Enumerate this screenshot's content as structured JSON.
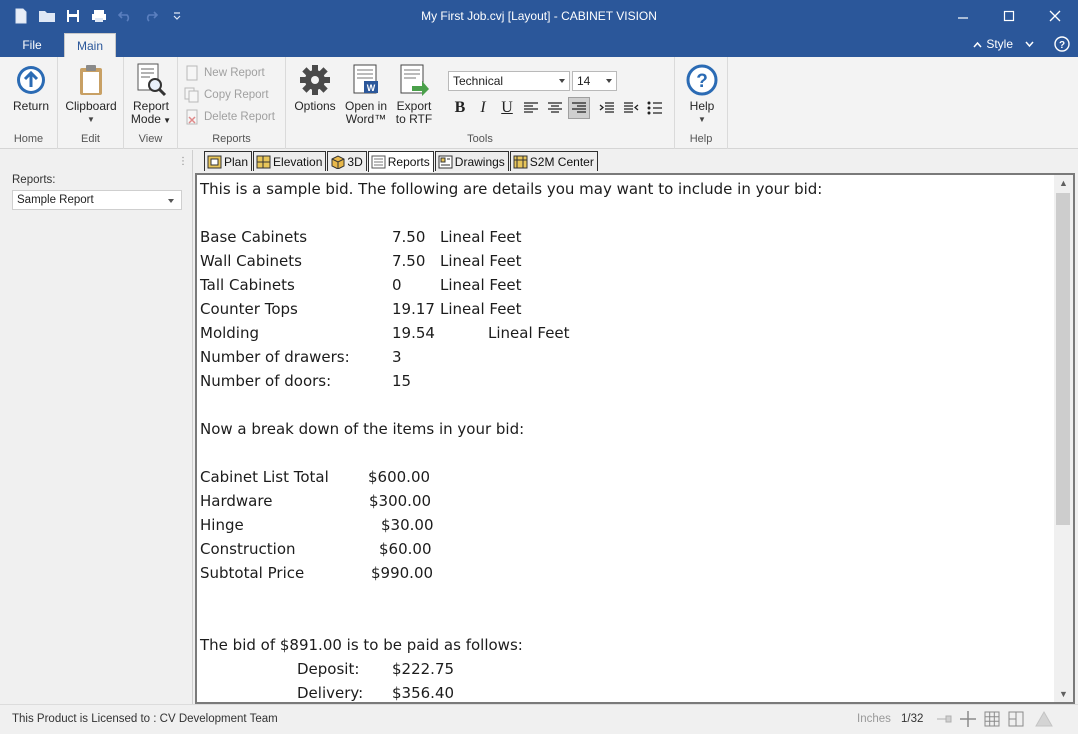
{
  "window": {
    "title": "My First Job.cvj [Layout] - CABINET VISION",
    "controls": {
      "minimize": "minimize-icon",
      "maximize": "maximize-icon",
      "close": "close-icon"
    }
  },
  "quick_access": [
    "new-file-icon",
    "open-folder-icon",
    "save-icon",
    "print-icon",
    "undo-icon",
    "redo-icon",
    "customize-qat-icon"
  ],
  "tabs": {
    "file": "File",
    "main": "Main",
    "style": "Style"
  },
  "ribbon": {
    "home": {
      "return_label": "Return",
      "group": "Home"
    },
    "edit": {
      "clipboard_label": "Clipboard",
      "group": "Edit"
    },
    "view": {
      "report_mode_line1": "Report",
      "report_mode_line2": "Mode",
      "group": "View"
    },
    "reports": {
      "new_report": "New Report",
      "copy_report": "Copy Report",
      "delete_report": "Delete Report",
      "group": "Reports"
    },
    "tools": {
      "options": "Options",
      "open_word_line1": "Open in",
      "open_word_line2": "Word™",
      "export_line1": "Export",
      "export_line2": "to RTF",
      "font": "Technical",
      "size": "14",
      "group": "Tools"
    },
    "help": {
      "label": "Help",
      "group": "Help"
    }
  },
  "left_panel": {
    "label": "Reports:",
    "selected_report": "Sample Report"
  },
  "doc_tabs": [
    "Plan",
    "Elevation",
    "3D",
    "Reports",
    "Drawings",
    "S2M Center"
  ],
  "report": {
    "intro": "This is a sample bid. The following are details you may want to include in your bid:",
    "details": [
      {
        "label": "Base Cabinets",
        "value": "7.50",
        "unit": "Lineal Feet"
      },
      {
        "label": "Wall Cabinets",
        "value": "7.50",
        "unit": "Lineal Feet"
      },
      {
        "label": "Tall Cabinets",
        "value": "0",
        "unit": "Lineal Feet"
      },
      {
        "label": "Counter Tops",
        "value": "19.17",
        "unit": "Lineal Feet"
      },
      {
        "label": "Molding",
        "value": "19.54",
        "unit": "Lineal Feet"
      },
      {
        "label": "Number of drawers:",
        "value": "3",
        "unit": ""
      },
      {
        "label": "Number of doors:",
        "value": "15",
        "unit": ""
      }
    ],
    "breakdown_heading": "Now a break down of the items in your bid:",
    "breakdown": [
      {
        "label": "Cabinet List Total",
        "value": "$600.00"
      },
      {
        "label": "Hardware",
        "value": "$300.00"
      },
      {
        "label": "Hinge",
        "value": "$30.00"
      },
      {
        "label": "Construction",
        "value": "$60.00"
      },
      {
        "label": "Subtotal Price",
        "value": "$990.00"
      }
    ],
    "bid_line": "The bid of $891.00 is to be paid as follows:",
    "payments": [
      {
        "label": "Deposit:",
        "value": "$222.75"
      },
      {
        "label": "Delivery:",
        "value": "$356.40"
      }
    ]
  },
  "status": {
    "license": "This Product is Licensed to : CV Development Team",
    "units": "Inches",
    "fraction": "1/32"
  },
  "colors": {
    "title_bar": "#2b579a",
    "ribbon": "#f3f3f3",
    "accent": "#2b579a"
  }
}
